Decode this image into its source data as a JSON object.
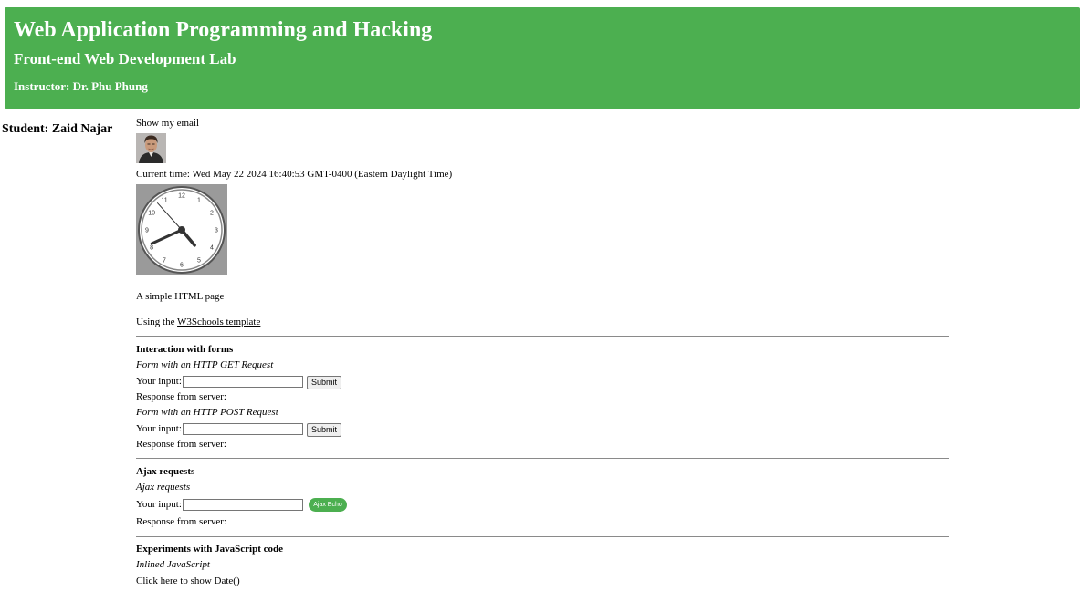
{
  "header": {
    "title": "Web Application Programming and Hacking",
    "subtitle": "Front-end Web Development Lab",
    "instructor": "Instructor: Dr. Phu Phung",
    "bg_color": "#4CAF50"
  },
  "student": "Student: Zaid Najar",
  "main": {
    "show_email": "Show my email",
    "current_time": "Current time: Wed May 22 2024 16:40:53 GMT-0400 (Eastern Daylight Time)",
    "clock": {
      "hours": 4,
      "minutes": 40,
      "seconds": 53,
      "numbers": [
        "12",
        "1",
        "2",
        "3",
        "4",
        "5",
        "6",
        "7",
        "8",
        "9",
        "10",
        "11"
      ]
    },
    "simple_page": "A simple HTML page",
    "using_prefix": "Using the ",
    "template_link": "W3Schools template",
    "forms": {
      "title": "Interaction with forms",
      "get_title": "Form with an HTTP GET Request",
      "post_title": "Form with an HTTP POST Request",
      "input_label": "Your input:",
      "submit_label": "Submit",
      "response_label": "Response from server:"
    },
    "ajax": {
      "title": "Ajax requests",
      "subtitle": "Ajax requests",
      "input_label": "Your input:",
      "button_label": "Ajax Echo",
      "response_label": "Response from server:"
    },
    "js": {
      "title": "Experiments with JavaScript code",
      "subtitle": "Inlined JavaScript",
      "show_date": "Click here to show Date()"
    }
  }
}
